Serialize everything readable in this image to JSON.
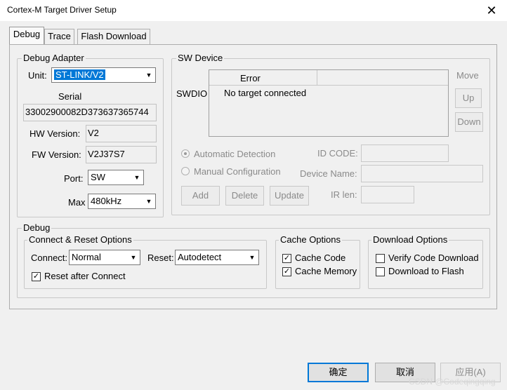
{
  "window": {
    "title": "Cortex-M Target Driver Setup",
    "close_glyph": "✕"
  },
  "tabs": [
    {
      "label": "Debug"
    },
    {
      "label": "Trace"
    },
    {
      "label": "Flash Download"
    }
  ],
  "debug_adapter": {
    "legend": "Debug Adapter",
    "unit_label": "Unit:",
    "unit_value": "ST-LINK/V2",
    "serial_label": "Serial",
    "serial_value": "33002900082D373637365744",
    "hw_label": "HW Version:",
    "hw_value": "V2",
    "fw_label": "FW Version:",
    "fw_value": "V2J37S7",
    "port_label": "Port:",
    "port_value": "SW",
    "max_label": "Max",
    "max_value": "480kHz"
  },
  "sw_device": {
    "legend": "SW Device",
    "move_label": "Move",
    "up_label": "Up",
    "down_label": "Down",
    "swdio_label": "SWDIO",
    "col_error": "Error",
    "row_text": "No target connected",
    "auto_detect": "Automatic Detection",
    "manual_config": "Manual Configuration",
    "id_code_label": "ID CODE:",
    "device_name_label": "Device Name:",
    "ir_len_label": "IR len:",
    "add_label": "Add",
    "delete_label": "Delete",
    "update_label": "Update"
  },
  "debug": {
    "legend": "Debug",
    "connect_reset": {
      "legend": "Connect & Reset Options",
      "connect_label": "Connect:",
      "connect_value": "Normal",
      "reset_label": "Reset:",
      "reset_value": "Autodetect",
      "reset_after_connect": "Reset after Connect",
      "reset_after_connect_checked": true
    },
    "cache": {
      "legend": "Cache Options",
      "cache_code": "Cache Code",
      "cache_code_checked": true,
      "cache_memory": "Cache Memory",
      "cache_memory_checked": true
    },
    "download": {
      "legend": "Download Options",
      "verify": "Verify Code Download",
      "verify_checked": false,
      "download_flash": "Download to Flash",
      "download_flash_checked": false
    }
  },
  "footer": {
    "ok_label": "确定",
    "cancel_label": "取消",
    "apply_label": "应用(A)"
  },
  "watermark": "CSDN @Codeqingqing",
  "glyphs": {
    "dropdown": "▼",
    "check": "✓"
  }
}
